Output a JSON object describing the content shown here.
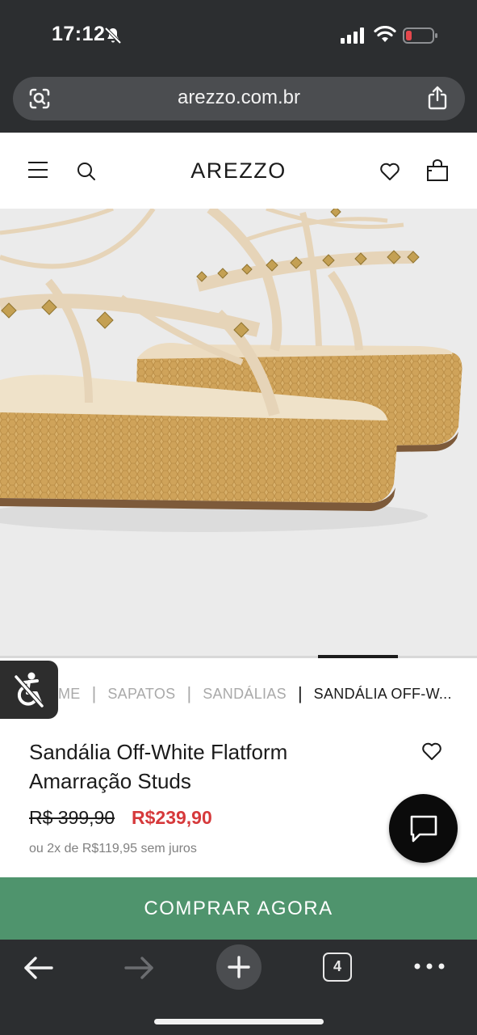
{
  "status_bar": {
    "time": "17:12",
    "icons": [
      "bell-slash-icon",
      "cellular-signal-icon",
      "wifi-icon",
      "battery-low-icon"
    ],
    "battery_color": "#e5484d"
  },
  "browser": {
    "url": "arezzo.com.br",
    "tab_count": "4"
  },
  "site_header": {
    "brand": "AREZZO"
  },
  "carousel": {
    "active_index": 4,
    "image_alt_subject": "sandalia-flatform-studs"
  },
  "breadcrumb": {
    "items": [
      "ME",
      "SAPATOS",
      "SANDÁLIAS",
      "SANDÁLIA OFF-W..."
    ]
  },
  "product": {
    "title_line1": "Sandália Off-White Flatform",
    "title_line2": "Amarração Studs",
    "price_old": "R$ 399,90",
    "price_new": "R$239,90",
    "installments": "ou 2x de R$119,95 sem juros"
  },
  "actions": {
    "buy_label": "COMPRAR AGORA"
  },
  "colors": {
    "buy_button": "#4f946d",
    "sale_price": "#d6393b",
    "chrome": "#2c2e30"
  }
}
